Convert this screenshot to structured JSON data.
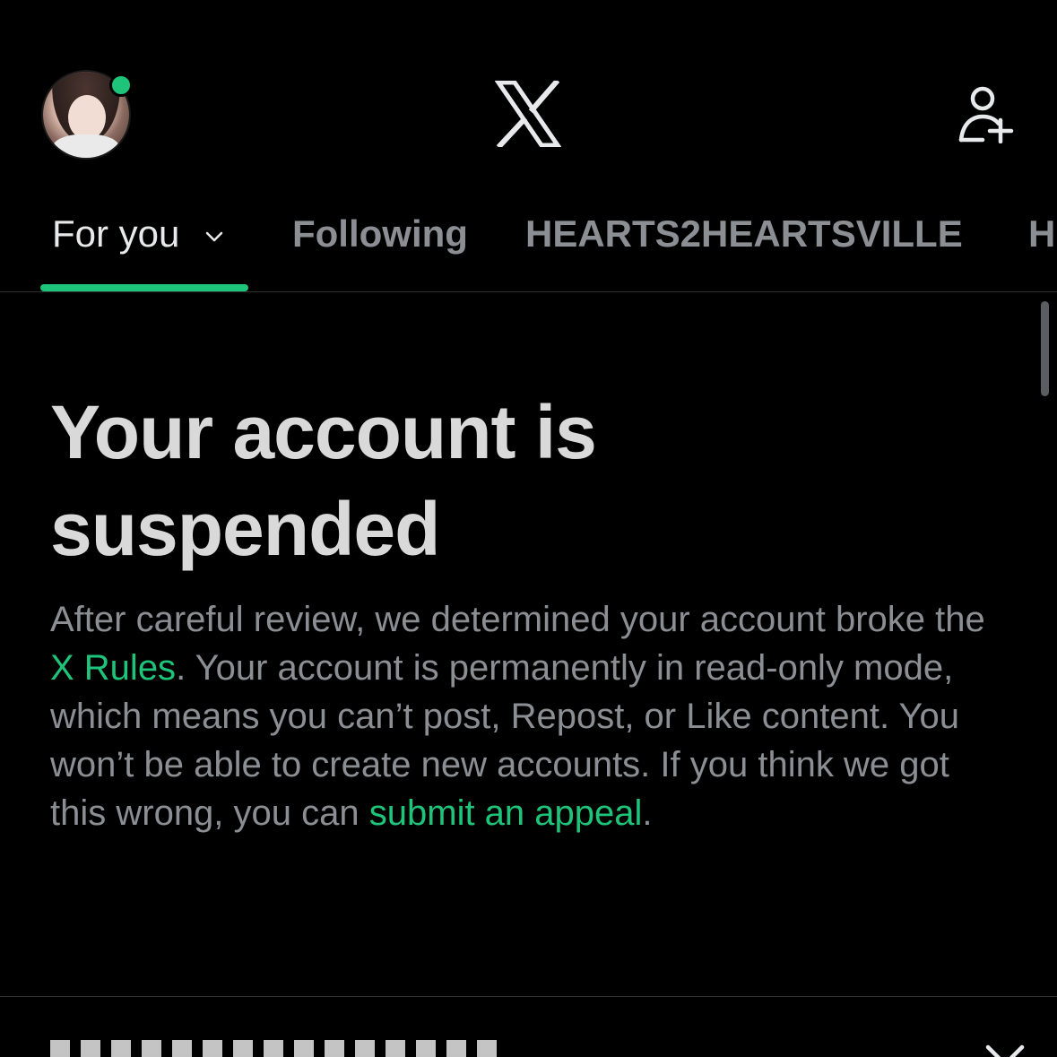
{
  "header": {
    "logo_label": "X",
    "avatar_alt": "profile avatar",
    "presence": "online",
    "add_user_icon": "add-user-icon"
  },
  "tabs": [
    {
      "label": "For you",
      "active": true
    },
    {
      "label": "Following",
      "active": false
    },
    {
      "label": "HEARTS2HEARTSVILLE",
      "active": false
    },
    {
      "label": "H",
      "active": false
    }
  ],
  "notice": {
    "title": "Your account is suspended",
    "body_part1": "After careful review, we determined your account broke the ",
    "rules_link": "X Rules",
    "body_part2": ". Your account is permanently in read-only mode, which means you can’t post, Repost, or Like content. You won’t be able to create new accounts. If you think we got this wrong, you can ",
    "appeal_link": "submit an appeal",
    "body_part3": "."
  },
  "colors": {
    "background": "#000000",
    "accent": "#1dc47a",
    "primary_text": "#e7e9ea",
    "secondary_text": "#8b8f93",
    "divider": "#2f3336"
  }
}
